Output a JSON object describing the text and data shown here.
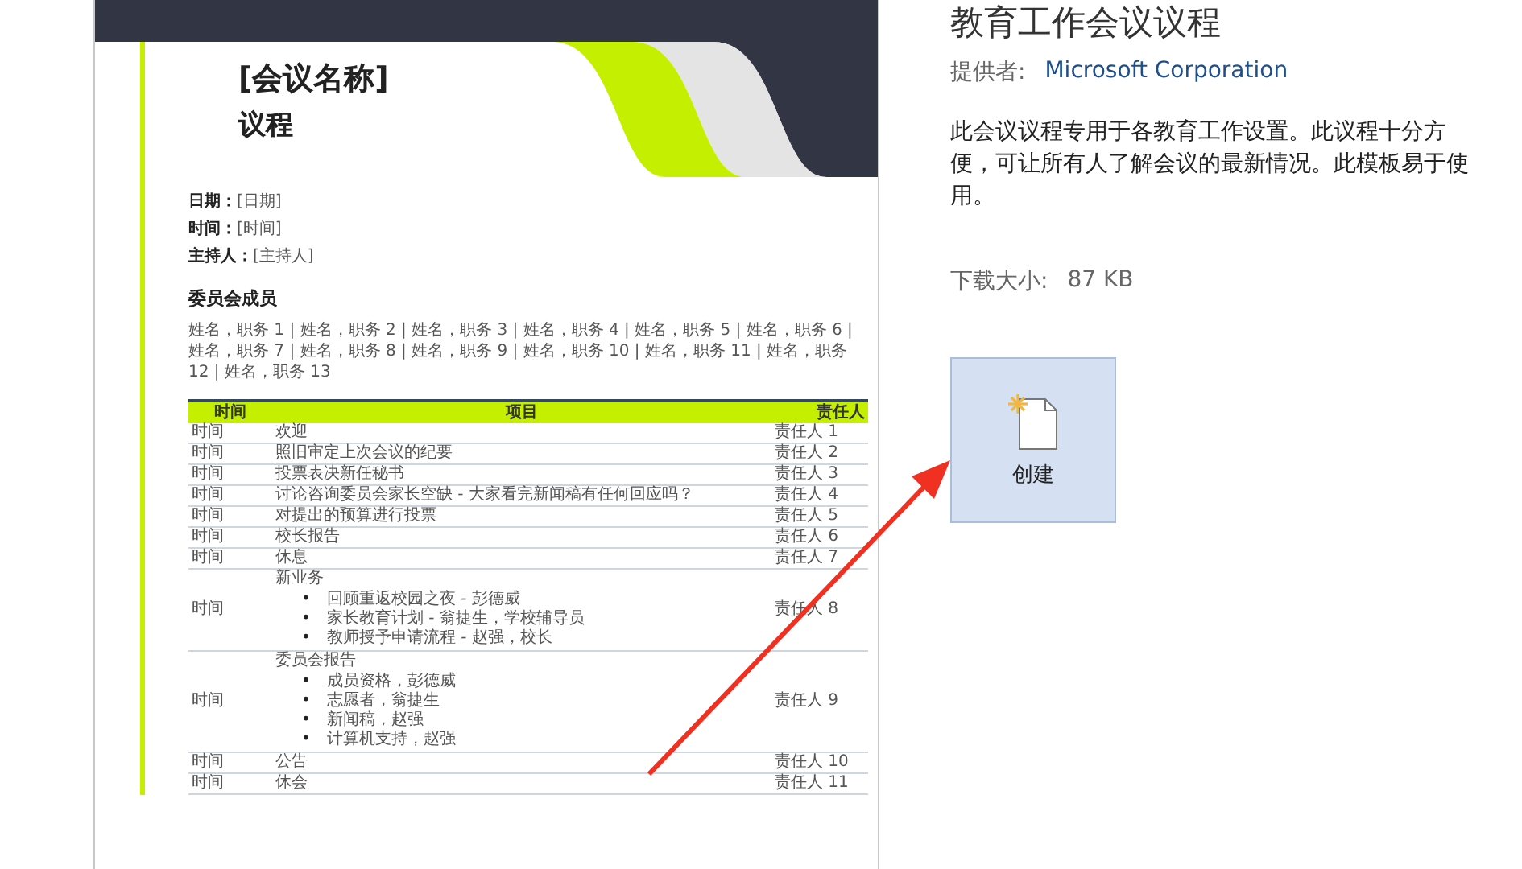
{
  "preview": {
    "meeting_name": "[会议名称]",
    "heading": "议程",
    "details": [
      {
        "label": "日期：",
        "value": "[日期]"
      },
      {
        "label": "时间：",
        "value": "[时间]"
      },
      {
        "label": "主持人：",
        "value": "[主持人]"
      }
    ],
    "members_heading": "委员会成员",
    "members": "姓名，职务 1 | 姓名，职务 2 | 姓名，职务 3 | 姓名，职务 4 | 姓名，职务 5 | 姓名，职务 6 | 姓名，职务 7 | 姓名，职务 8 | 姓名，职务 9 | 姓名，职务 10 | 姓名，职务 11 | 姓名，职务 12 | 姓名，职务 13",
    "table": {
      "columns": [
        "时间",
        "项目",
        "责任人"
      ],
      "rows": [
        {
          "kind": "simple",
          "time": "时间",
          "item": "欢迎",
          "owner": "责任人 1"
        },
        {
          "kind": "simple",
          "time": "时间",
          "item": "照旧审定上次会议的纪要",
          "owner": "责任人 2"
        },
        {
          "kind": "simple",
          "time": "时间",
          "item": "投票表决新任秘书",
          "owner": "责任人 3"
        },
        {
          "kind": "simple",
          "time": "时间",
          "item": "讨论咨询委员会家长空缺 - 大家看完新闻稿有任何回应吗？",
          "owner": "责任人 4"
        },
        {
          "kind": "simple",
          "time": "时间",
          "item": "对提出的预算进行投票",
          "owner": "责任人 5"
        },
        {
          "kind": "simple",
          "time": "时间",
          "item": "校长报告",
          "owner": "责任人 6"
        },
        {
          "kind": "simple",
          "time": "时间",
          "item": "休息",
          "owner": "责任人 7"
        },
        {
          "kind": "group",
          "time": "时间",
          "item": "新业务",
          "marker": "•",
          "bullets": [
            "回顾重返校园之夜 - 彭德威",
            "家长教育计划 - 翁捷生，学校辅导员",
            "教师授予申请流程 - 赵强，校长"
          ],
          "owner": "责任人 8"
        },
        {
          "kind": "group",
          "time": "时间",
          "item": "委员会报告",
          "marker": "•",
          "bullets": [
            "成员资格，彭德威",
            "志愿者，翁捷生",
            "新闻稿，赵强",
            "计算机支持，赵强"
          ],
          "owner": "责任人 9"
        },
        {
          "kind": "simple",
          "time": "时间",
          "item": "公告",
          "owner": "责任人 10"
        },
        {
          "kind": "simple",
          "time": "时间",
          "item": "休会",
          "owner": "责任人 11"
        }
      ]
    }
  },
  "details": {
    "title": "教育工作会议议程",
    "provider_label": "提供者:",
    "provider": "Microsoft Corporation",
    "description": "此会议议程专用于各教育工作设置。此议程十分方便，可让所有人了解会议的最新情况。此模板易于使用。",
    "size_label": "下载大小:",
    "size": "87 KB",
    "create_label": "创建"
  }
}
